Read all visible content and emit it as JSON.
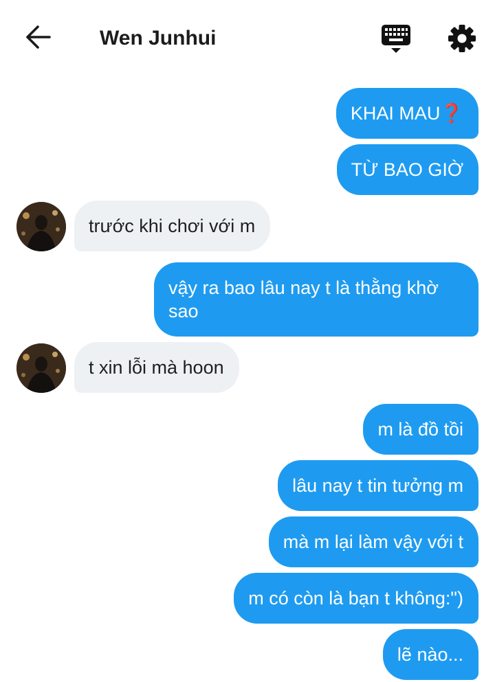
{
  "header": {
    "contact_name": "Wen Junhui",
    "back_icon": "arrow-left-icon",
    "keyboard_icon": "keyboard-icon",
    "settings_icon": "gear-icon"
  },
  "colors": {
    "sent_bubble": "#1e9bf0",
    "received_bubble": "#eef1f4"
  },
  "messages": [
    {
      "side": "sent",
      "text": "KHAI MAU❓"
    },
    {
      "side": "sent",
      "text": "TỪ BAO GIỜ"
    },
    {
      "side": "received",
      "text": "trước khi chơi với m"
    },
    {
      "side": "sent",
      "text": "vậy ra bao lâu nay t là thằng khờ sao"
    },
    {
      "side": "received",
      "text": "t xin lỗi mà hoon"
    },
    {
      "side": "sent",
      "text": "m là đồ tồi"
    },
    {
      "side": "sent",
      "text": "lâu nay t tin tưởng m"
    },
    {
      "side": "sent",
      "text": "mà m lại làm vậy với t"
    },
    {
      "side": "sent",
      "text": "m có còn là bạn t không:\")"
    },
    {
      "side": "sent",
      "text": "lẽ nào..."
    }
  ]
}
